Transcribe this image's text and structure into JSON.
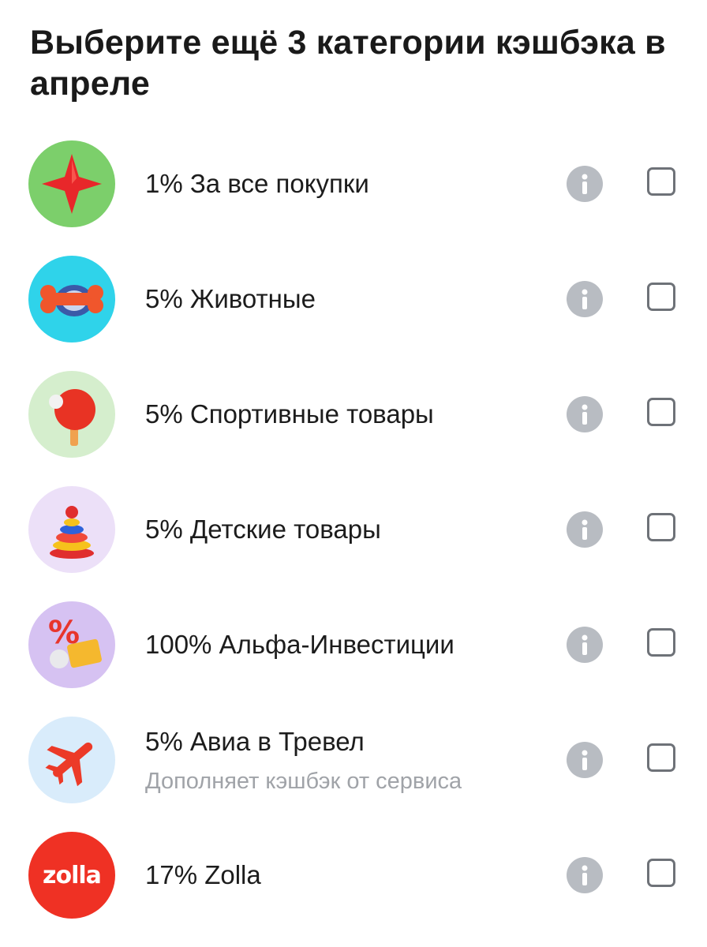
{
  "title": "Выберите ещё 3 категории кэшбэка в апреле",
  "categories": [
    {
      "label": "1% За все покупки",
      "icon": "red-star-icon",
      "bg": "#7ccf6b"
    },
    {
      "label": "5% Животные",
      "icon": "bone-icon",
      "bg": "#2fd3ea"
    },
    {
      "label": "5% Спортивные товары",
      "icon": "ping-pong-paddle-icon",
      "bg": "#d5eecd"
    },
    {
      "label": "5% Детские товары",
      "icon": "toy-pyramid-icon",
      "bg": "#ece0f8"
    },
    {
      "label": "100% Альфа-Инвестиции",
      "icon": "percent-coins-icon",
      "bg": "#d6c2f2"
    },
    {
      "label": "5% Авиа в Тревел",
      "sublabel": "Дополняет кэшбэк от сервиса",
      "icon": "airplane-icon",
      "bg": "#d9ecfb"
    },
    {
      "label": "17% Zolla",
      "icon": "zolla-logo-icon",
      "bg": "#ef3124",
      "logo_text": "zolla"
    }
  ]
}
